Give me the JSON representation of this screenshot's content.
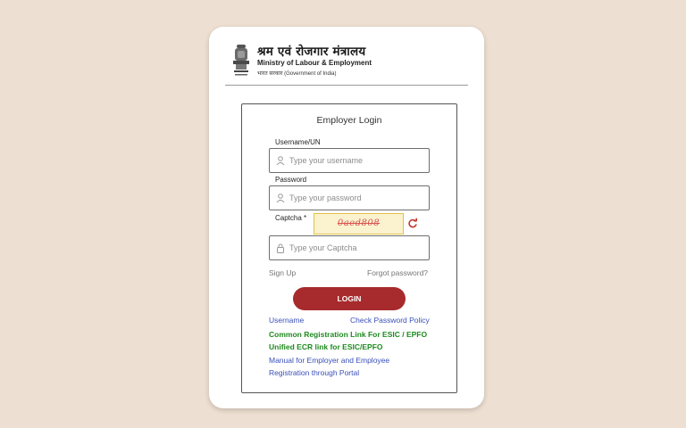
{
  "header": {
    "hindi_title": "श्रम एवं रोजगार मंत्रालय",
    "english_title": "Ministry of Labour & Employment",
    "gov_line": "भारत सरकार (Government of India)"
  },
  "login": {
    "title": "Employer Login",
    "username_label": "Username/UN",
    "username_placeholder": "Type your username",
    "password_label": "Password",
    "password_placeholder": "Type your password",
    "captcha_label": "Captcha *",
    "captcha_value": "0aed808",
    "captcha_placeholder": "Type your Captcha",
    "sign_up": "Sign Up",
    "forgot_password": "Forgot password?",
    "login_button": "LOGIN",
    "links": {
      "username": "Username",
      "check_password_policy": "Check Password Policy",
      "common_registration": "Common Registration Link For ESIC / EPFO",
      "unified_ecr": "Unified ECR link for ESIC/EPFO",
      "manual_line1": "Manual for Employer and Employee",
      "manual_line2": "Registration through Portal"
    }
  },
  "colors": {
    "background": "#eddfd1",
    "login_button": "#a72a2c",
    "link_blue": "#3a4fb8",
    "link_green": "#1f8a1f",
    "captcha_text": "#d9534f",
    "captcha_bg": "#fbf2cf"
  },
  "icons": {
    "emblem": "national-emblem-icon",
    "username": "user-icon",
    "password": "user-icon",
    "captcha": "lock-icon",
    "refresh": "refresh-icon"
  }
}
